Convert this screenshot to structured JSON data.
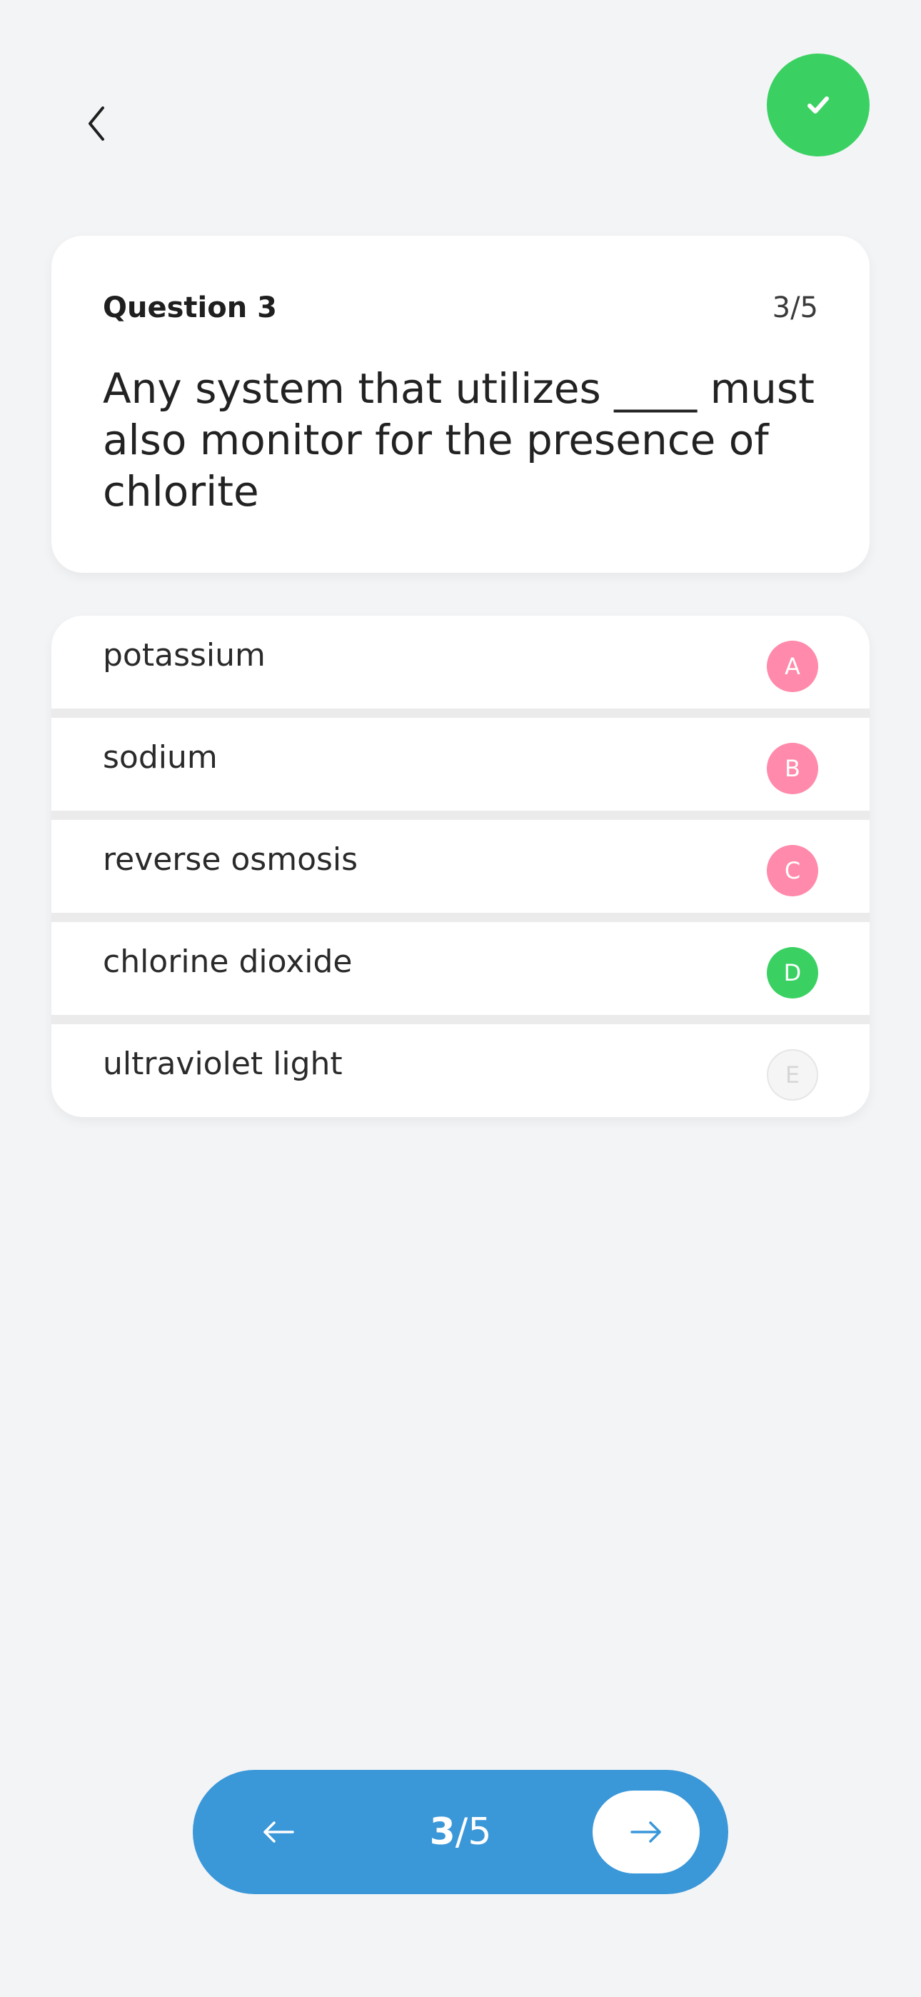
{
  "header": {
    "back_icon": "chevron-left-icon",
    "check_icon": "checkmark-icon",
    "check_color": "#3ad162"
  },
  "question": {
    "label": "Question 3",
    "counter": "3/5",
    "text": "Any system that utilizes ____ must also monitor for the presence of chlorite"
  },
  "options": [
    {
      "text": "potassium",
      "letter": "A",
      "state": "wrong",
      "badge_color": "#ff8aab"
    },
    {
      "text": "sodium",
      "letter": "B",
      "state": "wrong",
      "badge_color": "#ff8aab"
    },
    {
      "text": "reverse osmosis",
      "letter": "C",
      "state": "wrong",
      "badge_color": "#ff8aab"
    },
    {
      "text": "chlorine dioxide",
      "letter": "D",
      "state": "correct",
      "badge_color": "#3ad162"
    },
    {
      "text": "ultraviolet light",
      "letter": "E",
      "state": "neutral",
      "badge_color": "#f5f5f5"
    }
  ],
  "pager": {
    "current": "3",
    "separator": "/",
    "total": "5",
    "prev_icon": "arrow-left-icon",
    "next_icon": "arrow-right-icon",
    "bar_color": "#3a97d8"
  }
}
